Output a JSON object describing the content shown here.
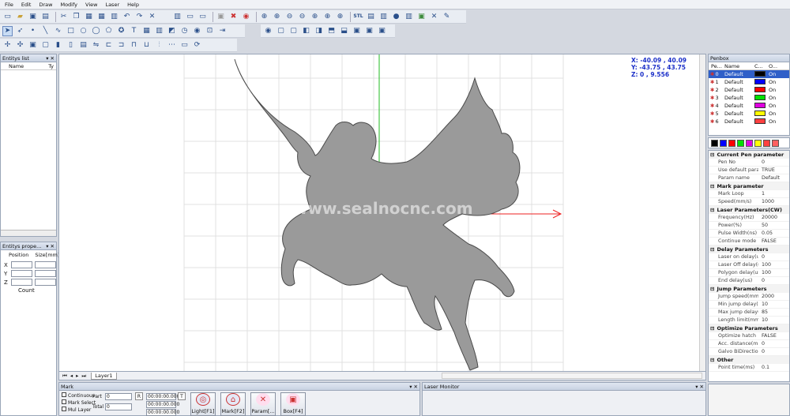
{
  "menu": [
    "File",
    "Edit",
    "Draw",
    "Modify",
    "View",
    "Laser",
    "Help"
  ],
  "entitys_list": {
    "title": "Entitys list",
    "col_name": "Name",
    "col_type": "Ty"
  },
  "entitys_prop": {
    "title": "Entitys prope...",
    "col_position": "Position",
    "col_size": "Size[mm]",
    "x": "X",
    "y": "Y",
    "z": "Z",
    "count": "Count"
  },
  "coords": {
    "x": "X: -40.09 , 40.09",
    "y": "Y: -43.75 , 43.75",
    "z": "Z: 0 , 9.556"
  },
  "watermark": "www.sealnocnc.com",
  "layer_tab": "Layer1",
  "penbox": {
    "title": "Penbox",
    "headers": [
      "Pe...",
      "Name",
      "C...",
      "O..."
    ],
    "pens": [
      {
        "no": "0",
        "name": "Default",
        "color": "#000000",
        "on": "On"
      },
      {
        "no": "1",
        "name": "Default",
        "color": "#0000ff",
        "on": "On"
      },
      {
        "no": "2",
        "name": "Default",
        "color": "#ff0000",
        "on": "On"
      },
      {
        "no": "3",
        "name": "Default",
        "color": "#00e000",
        "on": "On"
      },
      {
        "no": "4",
        "name": "Default",
        "color": "#e000e0",
        "on": "On"
      },
      {
        "no": "5",
        "name": "Default",
        "color": "#ffff00",
        "on": "On"
      },
      {
        "no": "6",
        "name": "Default",
        "color": "#ff4040",
        "on": "On"
      }
    ],
    "palette": [
      "#000000",
      "#0000ff",
      "#ff0000",
      "#00e000",
      "#e000e0",
      "#ffff00",
      "#ff4040",
      "#ff6060"
    ]
  },
  "props": [
    {
      "cat": "Current Pen parameter",
      "rows": [
        [
          "Pen No",
          "0"
        ],
        [
          "Use default param",
          "TRUE"
        ],
        [
          "Param name",
          "Default"
        ]
      ]
    },
    {
      "cat": "Mark parameter",
      "rows": [
        [
          "Mark Loop",
          "1"
        ],
        [
          "Speed(mm/s)",
          "1000"
        ]
      ]
    },
    {
      "cat": "Laser Parameters(CW)",
      "rows": [
        [
          "Frequency(Hz)",
          "20000"
        ],
        [
          "Power(%)",
          "50"
        ],
        [
          "Pulse Width(ns)",
          "0.05"
        ],
        [
          "Continue mode",
          "FALSE"
        ]
      ]
    },
    {
      "cat": "Delay Parameters",
      "rows": [
        [
          "Laser on delay(us)",
          "0"
        ],
        [
          "Laser Off delay(us)",
          "100"
        ],
        [
          "Polygon delay(us)",
          "100"
        ],
        [
          "End delay(us)",
          "0"
        ]
      ]
    },
    {
      "cat": "Jump Parameters",
      "rows": [
        [
          "Jump speed(mm/s)",
          "2000"
        ],
        [
          "Min jump delay(us)",
          "10"
        ],
        [
          "Max jump delay(us)",
          "85"
        ],
        [
          "Length limit(mm)",
          "10"
        ]
      ]
    },
    {
      "cat": "Optimize Parameters",
      "rows": [
        [
          "Optimize hatch",
          "FALSE"
        ],
        [
          "Acc. distance(mm)",
          "0"
        ],
        [
          "Galvo BiDirection o...",
          "0"
        ]
      ]
    },
    {
      "cat": "Other",
      "rows": [
        [
          "Point time(ms)",
          "0.1"
        ]
      ]
    }
  ],
  "mark": {
    "title": "Mark",
    "continuous": "Continuous",
    "mark_select": "Mark Select",
    "mul_layer": "Mul Layer",
    "part": "Part",
    "part_val": "0",
    "total": "Total",
    "total_val": "0",
    "r": "R",
    "t": "T",
    "time1": "00:00:00.000",
    "time2": "00:00:00.000",
    "time3": "00:00:00.000",
    "buttons": [
      "Light[F1]",
      "Mark[F2]",
      "Param[...",
      "Box[F4]"
    ]
  },
  "laser_monitor": "Laser Monitor"
}
